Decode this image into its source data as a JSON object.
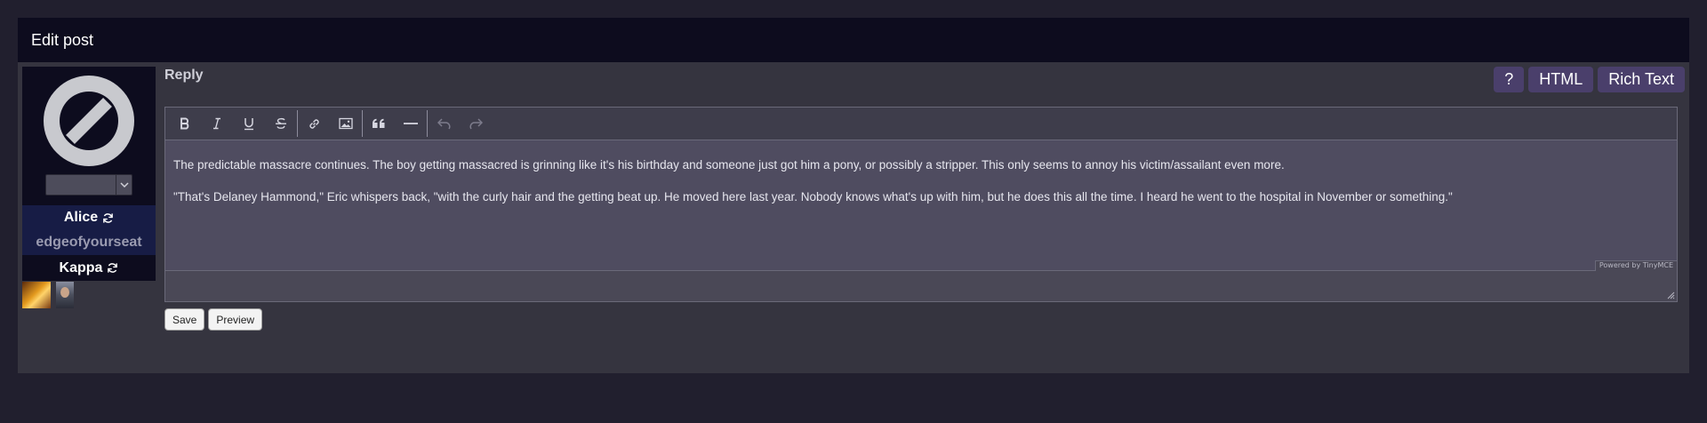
{
  "panel": {
    "title": "Edit post"
  },
  "sidebar": {
    "character_select_value": "",
    "character_name": "Alice",
    "username": "edgeofyourseat",
    "secondary_name": "Kappa"
  },
  "reply": {
    "title": "Reply"
  },
  "mode_buttons": {
    "help": "?",
    "html": "HTML",
    "rich_text": "Rich Text"
  },
  "editor": {
    "toolbar": [
      "bold-icon",
      "italic-icon",
      "underline-icon",
      "strikethrough-icon",
      "link-icon",
      "image-icon",
      "blockquote-icon",
      "horizontal-rule-icon",
      "undo-icon",
      "redo-icon"
    ],
    "paragraphs": [
      "The predictable massacre continues. The boy getting massacred is grinning like it's his birthday and someone just got him a pony, or possibly a stripper. This only seems to annoy his victim/assailant even more.",
      "\"That's Delaney Hammond,\" Eric whispers back, \"with the curly hair and the getting beat up. He moved here last year. Nobody knows what's up with him, but he does this all the time. I heard he went to the hospital in November or something.\""
    ],
    "powered_by": "Powered by TinyMCE"
  },
  "actions": {
    "save": "Save",
    "preview": "Preview"
  },
  "colors": {
    "page_bg": "#211f2e",
    "panel_bg": "#35343f",
    "header_bg": "#0d0c1e",
    "accent": "#4a3f6b"
  }
}
